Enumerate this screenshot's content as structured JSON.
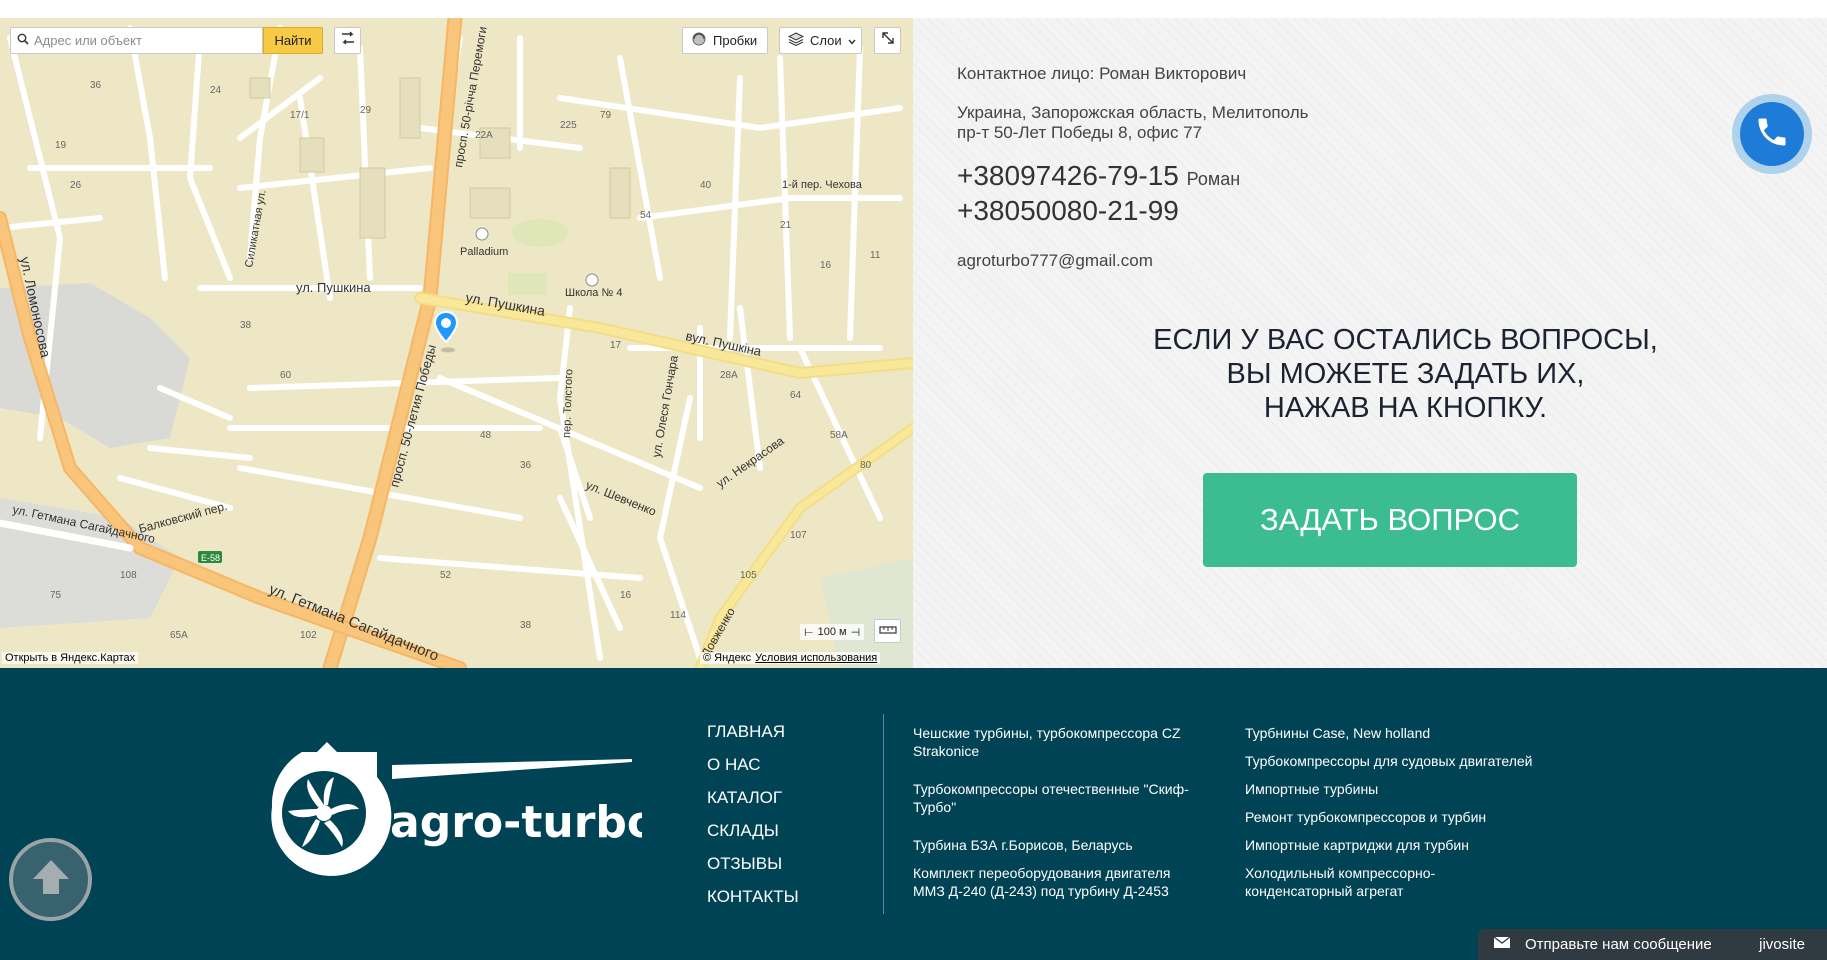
{
  "map": {
    "search_placeholder": "Адрес или объект",
    "find_button": "Найти",
    "traffic_button": "Пробки",
    "layers_button": "Слои",
    "scale": "100 м",
    "open_link": "Открыть в Яндекс.Картах",
    "copyright": "© Яндекс",
    "terms": "Условия использования",
    "labels": {
      "pushkina1": "ул. Пушкина",
      "pushkina2": "ул. Пушкина",
      "pushkina3": "вул. Пушкіна",
      "pobedy": "просп. 50-летия Победы",
      "pobedy_ua": "просп. 50-річча Перемоги",
      "lomonosova": "ул. Ломоносова",
      "getmana1": "ул. Гетмана Сагайдачного",
      "getmana2": "ул. Гетмана Сагайдачного",
      "shevchenko": "ул. Шевченко",
      "nekrasova": "ул. Некрасова",
      "goncharova": "ул. Олеся Гончара",
      "balkovsky": "Балковский пер.",
      "tolstogo": "пер. Толстого",
      "chehova": "1-й пер. Чехова",
      "dovzhenko": "Довженко",
      "silikat": "Силикатная ул.",
      "palladium": "Palladium",
      "school": "Школа № 4",
      "road_e58": "E-58"
    }
  },
  "contacts": {
    "person": "Контактное лицо: Роман Викторович",
    "address_line1": "Украина, Запорожская область, Мелитополь",
    "address_line2": "пр-т 50-Лет Победы 8, офис 77",
    "phone1": "+38097426-79-15",
    "phone1_name": "Роман",
    "phone2": "+38050080-21-99",
    "email": "agroturbo777@gmail.com",
    "questions_line1": "ЕСЛИ У ВАС ОСТАЛИСЬ ВОПРОСЫ,",
    "questions_line2": "ВЫ МОЖЕТЕ ЗАДАТЬ ИХ,",
    "questions_line3": "НАЖАВ НА КНОПКУ.",
    "ask_button": "ЗАДАТЬ ВОПРОС"
  },
  "footer": {
    "logo_text": "agro-turbo",
    "nav": [
      "ГЛАВНАЯ",
      "О НАС",
      "КАТАЛОГ",
      "СКЛАДЫ",
      "ОТЗЫВЫ",
      "КОНТАКТЫ"
    ],
    "col1": [
      "Чешские турбины, турбокомпрессора CZ Strakonice",
      "Турбокомпрессоры отечественные \"Скиф-Турбо\"",
      "Турбина БЗА г.Борисов, Беларусь",
      "Комплект переоборудования двигателя ММЗ Д-240 (Д-243) под турбину Д-2453"
    ],
    "col2": [
      "Турбнины Case, New holland",
      "Турбокомпрессоры для судовых двигателей",
      "Импортные турбины",
      "Ремонт турбокомпрессоров и турбин",
      "Импортные картриджи для турбин",
      "Холодильный компрессорно-конденсаторный агрегат"
    ],
    "chat_text": "Отправьте нам сообщение",
    "chat_brand": "jivosite"
  },
  "colors": {
    "footer_bg": "#004354",
    "ask_button": "#3cbd91",
    "call_button": "#1f7bd8",
    "map_find": "#f7c944"
  },
  "icons": [
    "search-icon",
    "route-icon",
    "traffic-icon",
    "layers-icon",
    "chevron-down-icon",
    "fullscreen-icon",
    "ruler-icon",
    "map-pin-icon",
    "phone-icon",
    "arrow-up-icon",
    "mail-icon",
    "turbo-logo-icon"
  ]
}
